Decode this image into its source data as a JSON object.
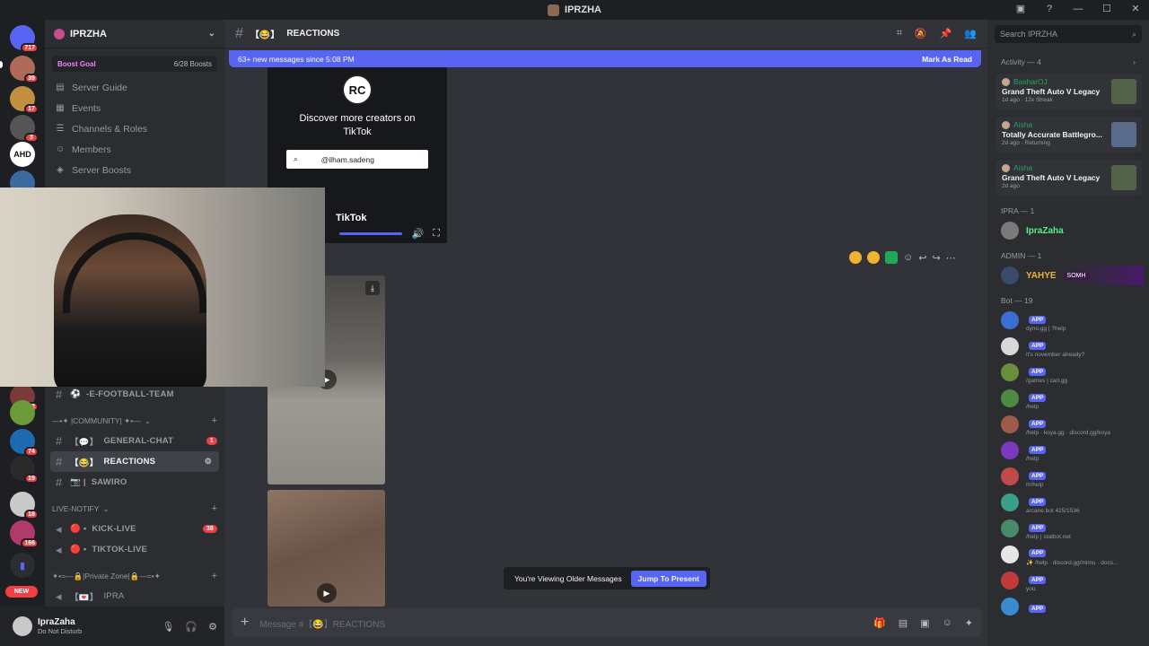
{
  "titlebar": {
    "title": "IPRZHA"
  },
  "rail": {
    "badges": [
      "717",
      "39",
      "17",
      "3",
      "102",
      "74",
      "19",
      "18",
      "166"
    ],
    "new_label": "NEW",
    "ahd_label": "AHD"
  },
  "sidebar": {
    "guild_name": "IPRZHA",
    "boost_goal": "Boost Goal",
    "boost_count": "6/28 Boosts",
    "items": [
      "Server Guide",
      "Events",
      "Channels & Roles",
      "Members",
      "Server Boosts"
    ],
    "channels_top": [
      {
        "name": "-E-FOOTBALL-TEAM",
        "prefix": "⚽"
      }
    ],
    "category_community": "—•✦ |COMMUNITY| ✦•—",
    "channels_community": [
      {
        "name": "GENERAL-CHAT",
        "prefix": "【💬】",
        "badge": "1"
      },
      {
        "name": "REACTIONS",
        "prefix": "【😂】",
        "active": true
      },
      {
        "name": "SAWIRO",
        "prefix": "📷 |"
      }
    ],
    "category_live": "LIVE-NOTIFY",
    "channels_live": [
      {
        "name": "KICK-LIVE",
        "prefix": "🔴 •",
        "badge": "38"
      },
      {
        "name": "TIKTOK-LIVE",
        "prefix": "🔴 •"
      }
    ],
    "category_private": "✦•=—🔒|Private Zone|🔒—=•✦",
    "channels_private": [
      {
        "name": "IPRA",
        "prefix": "【💌】"
      }
    ]
  },
  "user": {
    "name": "IpraZaha",
    "status": "Do Not Disturb"
  },
  "channel": {
    "name": "REACTIONS",
    "prefix": "【😂】",
    "new_messages": "63+ new messages since 5:08 PM",
    "mark_read": "Mark As Read"
  },
  "tiktok": {
    "logo_initials": "RC",
    "discover": "Discover more creators on TikTok",
    "search": "@ilham.sadeng",
    "brand": "TikTok",
    "time": "09"
  },
  "older_bar": {
    "text": "You're Viewing Older Messages",
    "jump": "Jump To Present"
  },
  "composer": {
    "placeholder": "Message #【😂】REACTIONS"
  },
  "members": {
    "search": "Search IPRZHA",
    "activity_header": "Activity — 4",
    "activities": [
      {
        "user": "BasharOJ",
        "game": "Grand Theft Auto V Legacy",
        "meta": "1d ago · 12x Streak"
      },
      {
        "user": "Aisha",
        "game": "Totally Accurate Battlegro...",
        "meta": "2d ago · Returning"
      },
      {
        "user": "Aisha",
        "game": "Grand Theft Auto V Legacy",
        "meta": "2d ago"
      }
    ],
    "role_ipra": "IPRA — 1",
    "ipra_member": "IpraZaha",
    "role_admin": "ADMIN — 1",
    "admin_member": "YAHYE",
    "admin_tag": "SOMH",
    "role_bot": "Bot — 19",
    "bot_tag": "APP",
    "bots": [
      {
        "status": "dyno.gg | ?help",
        "color": "#3b6fd4"
      },
      {
        "status": "it's november already?",
        "color": "#d8d8d8"
      },
      {
        "status": "/games | carl.gg",
        "color": "#6b8e3a"
      },
      {
        "status": "/help",
        "color": "#4d8a44"
      },
      {
        "status": "/help · koya.gg · discord.gg/koya",
        "color": "#a05a4a"
      },
      {
        "status": "/help",
        "color": "#7a3ac0"
      },
      {
        "status": "m!help",
        "color": "#c04a4a"
      },
      {
        "status": "arcane.bot 425/1536",
        "color": "#3aa08a"
      },
      {
        "status": "/help | statbot.net",
        "color": "#4a8a6a"
      },
      {
        "status": "✨ /help · discord.gg/mimu · docs...",
        "color": "#e6e6e6"
      },
      {
        "status": "you.",
        "color": "#c03a3a"
      },
      {
        "status": "",
        "color": "#3a8ad0"
      }
    ]
  }
}
